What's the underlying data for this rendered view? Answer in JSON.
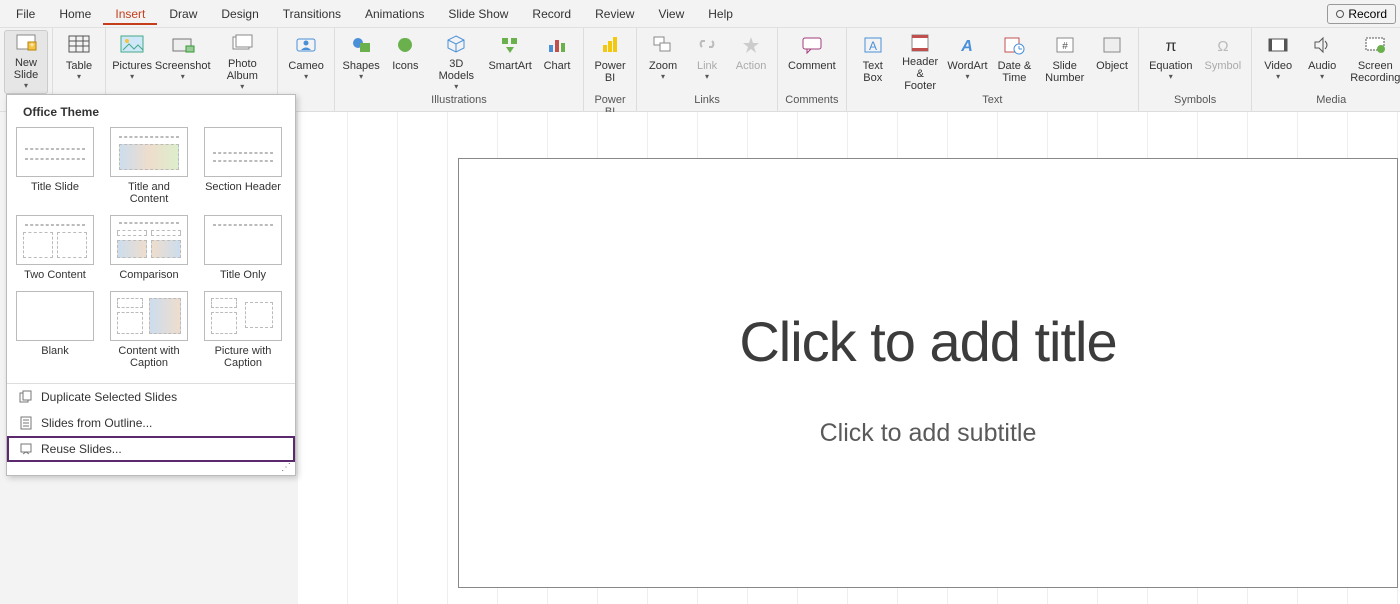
{
  "menubar": {
    "items": [
      "File",
      "Home",
      "Insert",
      "Draw",
      "Design",
      "Transitions",
      "Animations",
      "Slide Show",
      "Record",
      "Review",
      "View",
      "Help"
    ],
    "active_index": 2,
    "record_label": "Record"
  },
  "ribbon": {
    "new_slide": "New Slide",
    "table": "Table",
    "pictures": "Pictures",
    "screenshot": "Screenshot",
    "photo_album": "Photo Album",
    "cameo": "Cameo",
    "shapes": "Shapes",
    "icons": "Icons",
    "models3d": "3D Models",
    "smartart": "SmartArt",
    "chart": "Chart",
    "power_bi": "Power BI",
    "zoom": "Zoom",
    "link": "Link",
    "action": "Action",
    "comment": "Comment",
    "textbox": "Text Box",
    "header_footer": "Header & Footer",
    "wordart": "WordArt",
    "date_time": "Date & Time",
    "slide_number": "Slide Number",
    "object": "Object",
    "equation": "Equation",
    "symbol": "Symbol",
    "video": "Video",
    "audio": "Audio",
    "screen_recording": "Screen Recording",
    "groups": {
      "illustrations": "Illustrations",
      "power_bi": "Power BI",
      "links": "Links",
      "comments": "Comments",
      "text": "Text",
      "symbols": "Symbols",
      "media": "Media"
    }
  },
  "dropdown": {
    "header": "Office Theme",
    "layouts": [
      "Title Slide",
      "Title and Content",
      "Section Header",
      "Two Content",
      "Comparison",
      "Title Only",
      "Blank",
      "Content with Caption",
      "Picture with Caption"
    ],
    "duplicate": "Duplicate Selected Slides",
    "from_outline": "Slides from Outline...",
    "reuse": "Reuse Slides..."
  },
  "slide": {
    "title_placeholder": "Click to add title",
    "subtitle_placeholder": "Click to add subtitle"
  }
}
